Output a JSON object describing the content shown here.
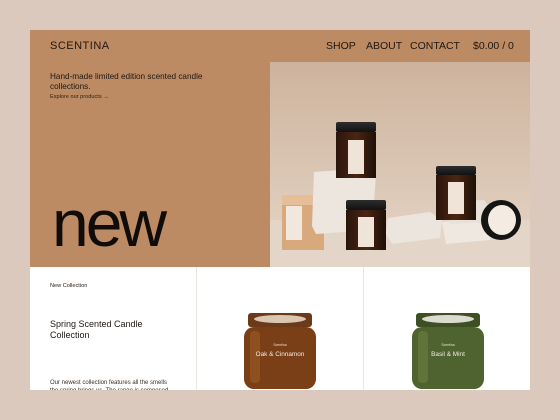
{
  "header": {
    "brand": "SCENTINA",
    "nav": [
      "SHOP",
      "ABOUT",
      "CONTACT"
    ],
    "cart": "$0.00 / 0"
  },
  "hero": {
    "tagline": "Hand-made limited edition scented candle collections.",
    "explore_link": "Explore our products →",
    "headline": "new"
  },
  "collection": {
    "eyebrow": "New Collection",
    "title": "Spring Scented Candle Collection",
    "description": "Our newest collection features all the smells the spring brings us. The range is composed"
  },
  "products": [
    {
      "brand": "Scentina",
      "name": "Oak & Cinnamon",
      "color": "#6b3a17"
    },
    {
      "brand": "Scentina",
      "name": "Basil & Mint",
      "color": "#4d5e2c"
    }
  ],
  "colors": {
    "page_background": "#dcc9be",
    "hero_accent": "#bc8a63",
    "text_dark": "#1f1812"
  }
}
